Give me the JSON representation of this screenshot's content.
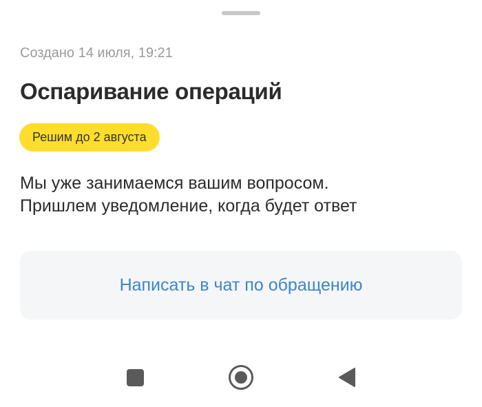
{
  "sheet": {
    "created_text": "Создано 14 июля, 19:21",
    "title": "Оспаривание операций",
    "badge": "Решим до 2 августа",
    "message_lines": [
      "Мы уже занимаемся вашим вопросом.",
      "Пришлем уведомление, когда будет ответ"
    ],
    "chat_button_label": "Написать в чат по обращению"
  },
  "colors": {
    "badge_bg": "#ffdd2d",
    "link_blue": "#3d86c6",
    "button_bg": "#f5f6f8",
    "muted_text": "#9a9a9e"
  },
  "navbar": {
    "icons": [
      "recent-apps-icon",
      "home-icon",
      "back-icon"
    ]
  }
}
